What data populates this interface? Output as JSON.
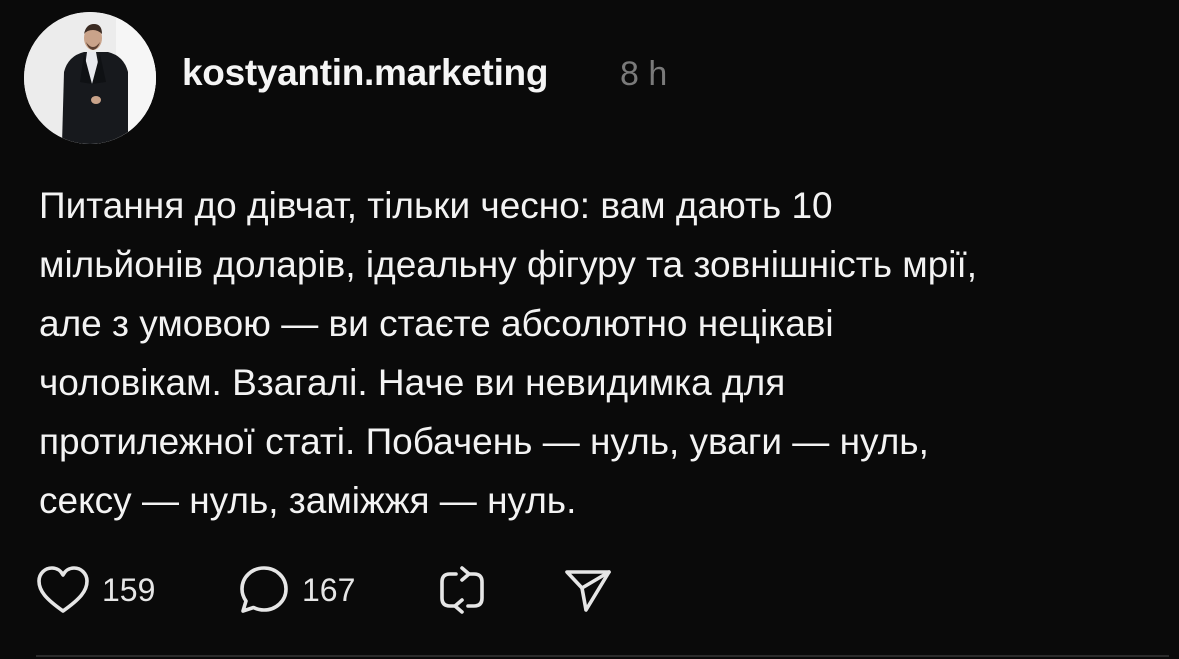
{
  "post": {
    "username": "kostyantin.marketing",
    "timestamp": "8 h",
    "text_lines": [
      "Питання до дівчат, тільки чесно: вам дають 10",
      "мільйонів доларів, ідеальну фігуру та зовнішність мрії,",
      "але з умовою — ви стаєте абсолютно нецікаві",
      "чоловікам. Взагалі. Наче ви невидимка для",
      "протилежної статі. Побачень — нуль, уваги — нуль,",
      "сексу — нуль, заміжжя — нуль."
    ]
  },
  "actions": {
    "like": {
      "icon": "heart-icon",
      "count": "159"
    },
    "comment": {
      "icon": "comment-bubble-icon",
      "count": "167"
    },
    "repost": {
      "icon": "repost-icon"
    },
    "share": {
      "icon": "send-icon"
    }
  },
  "colors": {
    "background": "#0a0a0a",
    "text": "#f3f3f3",
    "timestamp": "#7a7a7a"
  }
}
